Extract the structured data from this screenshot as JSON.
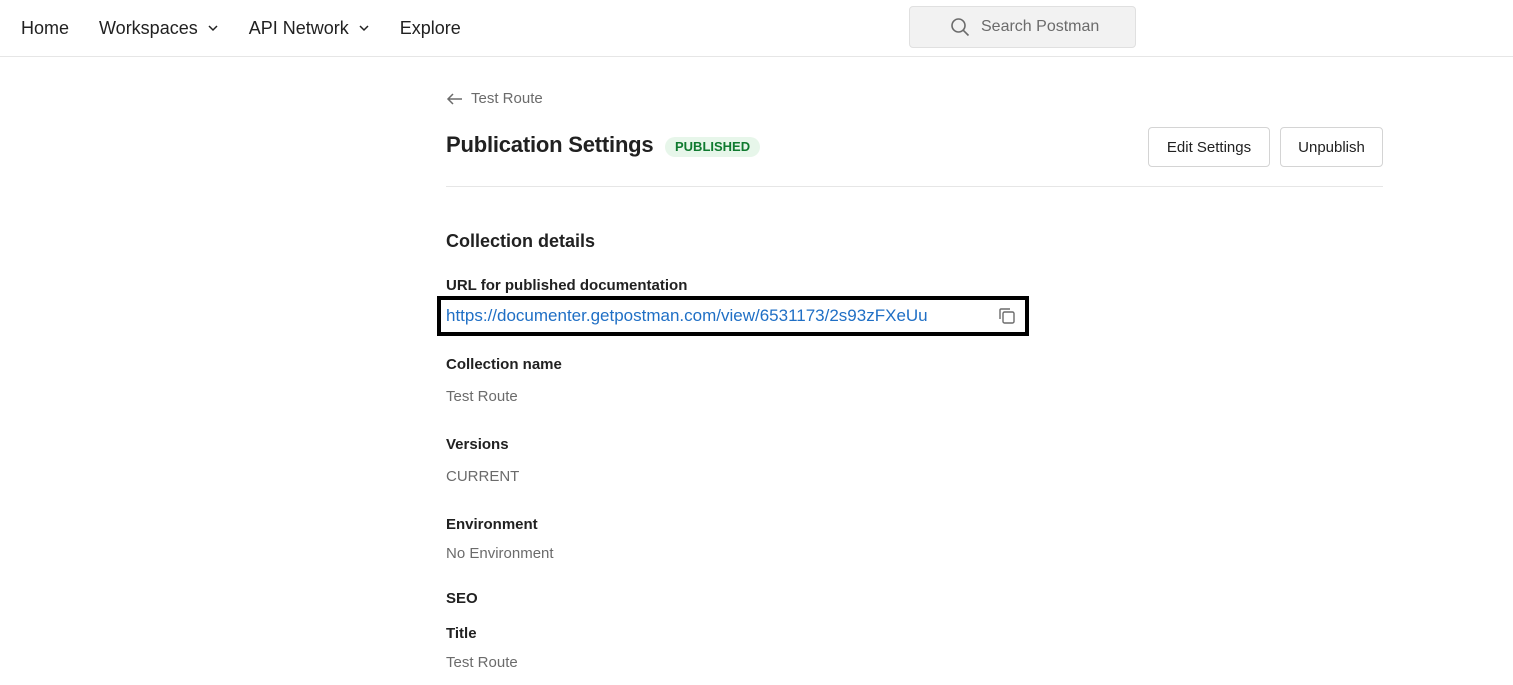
{
  "nav": {
    "items": [
      {
        "label": "Home"
      },
      {
        "label": "Workspaces"
      },
      {
        "label": "API Network"
      },
      {
        "label": "Explore"
      }
    ]
  },
  "search": {
    "placeholder": "Search Postman"
  },
  "back_link": {
    "label": "Test Route"
  },
  "header": {
    "title": "Publication Settings",
    "status_badge": "PUBLISHED",
    "edit_button": "Edit Settings",
    "unpublish_button": "Unpublish"
  },
  "collection_details": {
    "section_title": "Collection details",
    "url_label": "URL for published documentation",
    "url_value": "https://documenter.getpostman.com/view/6531173/2s93zFXeUu",
    "name_label": "Collection name",
    "name_value": "Test Route",
    "versions_label": "Versions",
    "versions_value": "CURRENT",
    "environment_label": "Environment",
    "environment_value": "No Environment",
    "seo_label": "SEO",
    "title_label": "Title",
    "title_value": "Test Route"
  },
  "colors": {
    "badge_bg": "#e7f6ea",
    "badge_text": "#0f7a2f",
    "link": "#1f6fc5",
    "highlight_border": "#000000"
  },
  "icons": {
    "chevron": "chevron-down-icon",
    "search": "search-icon",
    "back": "arrow-left-icon",
    "copy": "copy-icon"
  }
}
